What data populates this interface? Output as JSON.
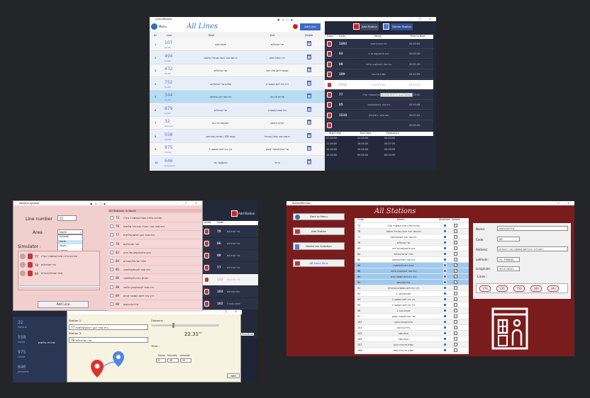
{
  "lines_window": {
    "title": "Lines Window",
    "menu": "Menu",
    "heading": "All Lines",
    "add_line": "Add Line",
    "add_station": "Add Station",
    "delete_station": "Delete Station",
    "cols": {
      "id": "ID",
      "line": "Line",
      "start": "Start",
      "end": "End",
      "delete": "Delete"
    },
    "rows": [
      {
        "id": "1",
        "num": "107",
        "area": "South",
        "start": "שכונת משה",
        "end": "שרי ישראל/ים"
      },
      {
        "id": "2",
        "num": "494",
        "area": "South",
        "start": "יח ספר צבר באור/ בוגרחיל אלמנת",
        "end": "דרך אלוף/ תשש"
      },
      {
        "id": "3",
        "num": "472",
        "area": "South",
        "start": "שרי ישראל/ים",
        "end": "שמואל ידיים/ מלך יקים"
      },
      {
        "id": "4",
        "num": "752",
        "area": "South",
        "start": "מסיטון שרי ישראל/יטב",
        "end": "דרך ביח לחם השושני ק"
      },
      {
        "id": "5",
        "num": "344",
        "area": "South",
        "start": "בית ספר רע/ בנישלחב",
        "end": "שדרות ולה מכי"
      },
      {
        "id": "6",
        "num": "879",
        "area": "South",
        "start": "שרי ישראל/ים",
        "end": "ביח שמחה/משמרת"
      },
      {
        "id": "7",
        "num": "32",
        "area": "General",
        "start": "יעקב/שדרות העת",
        "end": "שדרות אלשמן"
      },
      {
        "id": "8",
        "num": "558",
        "area": "Center",
        "start": "קאפר 700 / שדרות גנות יעקב",
        "end": "יח ספר צבר באור/ בוגרחיל"
      },
      {
        "id": "9",
        "num": "975",
        "area": "Center",
        "start": "דרך ביח לחם השושנה 2",
        "end": "שרי ישראל/שמירי קאופן"
      },
      {
        "id": "10",
        "num": "646",
        "area": "Jerusalem",
        "start": "ראשון/שד' נוה",
        "end": "ברחל"
      }
    ],
    "station_cols": {
      "index": "Index",
      "code": "Code",
      "name": "Name",
      "time": "Time to Next"
    },
    "stations": [
      {
        "code": "1492",
        "name": "בית חבן/רב שמש",
        "time": "00:32:04"
      },
      {
        "code": "83",
        "name": "בכון אלופה/מש של מ",
        "time": "00:09:36"
      },
      {
        "code": "89",
        "name": "בית ספר לבנות/בכון אלמה",
        "time": "00:51:39"
      },
      {
        "code": "109",
        "name": "עשרת מרכזרוד",
        "time": "00:14:09"
      },
      {
        "code": "1511",
        "name": "עשרת מרכזרוד",
        "time": "00:27:01"
      },
      {
        "code": "77",
        "name": "שדרות גולדה מאיר/המשורר אצ\"ג",
        "time": "00:25:42"
      },
      {
        "code": "85",
        "name": "בית ספר לבנות/אלמוגה",
        "time": "00:55:06"
      },
      {
        "code": "1510",
        "name": "קפרא/ים / דשל/עלם",
        "time": "00:07:02"
      },
      {
        "code": "",
        "name": "",
        "time": "00:00:00"
      }
    ],
    "tooltip": "Double Click to view Details",
    "freq_cols": {
      "start": "Start time",
      "end": "End time",
      "freq": "Frequency"
    },
    "freq_rows": [
      {
        "start": "07:00:00",
        "end": "12:05:00",
        "freq": "00:23:00"
      },
      {
        "start": "11:00:00",
        "end": "16:05:00",
        "freq": "00:37:00"
      },
      {
        "start": "15:00:00",
        "end": "20:05:00",
        "freq": "00:29:00"
      },
      {
        "start": "19:00:00",
        "end": "00:05:00",
        "freq": "00:29:00"
      }
    ]
  },
  "addline_window": {
    "title": "AddLine_window",
    "line_number_label": "Line number",
    "line_number_value": "12",
    "area_label": "Area",
    "area_value": "North",
    "area_options": [
      "General",
      "North",
      "South",
      "Center",
      "Jerusalem"
    ],
    "simulator_label": "Simulator :",
    "sim_items": [
      {
        "code": "77",
        "name": "שדרות גולדה מאיר/המשורר אצ\"ג"
      },
      {
        "code": "78",
        "name": "שרי ישראל/ים"
      },
      {
        "code": "84",
        "name": "מלכי ישראל/הטורים"
      }
    ],
    "add_line": "Add Line",
    "all_stations_label": "All Stations in North",
    "north_stations": [
      {
        "code": "73",
        "name": "שדרות גולדה מאיר/המשורר אצ\"ג"
      },
      {
        "code": "76",
        "name": "בית ספר צבר באור/ בוגרחיל אלמנת"
      },
      {
        "code": "77",
        "name": "בית ספר אבן יהושע/אלמנת"
      },
      {
        "code": "78",
        "name": "שרי ישראל/ים"
      },
      {
        "code": "83",
        "name": "בכון אלופה/מש של מרב"
      },
      {
        "code": "84",
        "name": "מלכי ישראל/הטורים"
      },
      {
        "code": "85",
        "name": "בית ספר לבנות/אלמוגה"
      },
      {
        "code": "86",
        "name": "מגרש כדורגל/אלמוגה"
      },
      {
        "code": "88",
        "name": "בית ספר לבנות/בכון אלמה"
      },
      {
        "code": "89",
        "name": "דרך בית לחם השושני קודם"
      },
      {
        "code": "90",
        "name": "גולדה/הרסום"
      }
    ],
    "bg_index": "Index",
    "bg_code": "Code",
    "bg_add_station": "Add Station",
    "bg_codes": [
      "78",
      "86",
      "89",
      "77",
      "112",
      "103",
      "102"
    ],
    "bg_names": [
      "שרי ישראל/ים",
      "שרי ישראל/ים",
      "שרי ישראל/ים",
      "שרי ישראל/ים",
      "שרי ישראל/ים",
      "גולדה/הרסום",
      "שכונת בוכה 2"
    ],
    "bg_end_time": "End time",
    "bg_lines": [
      {
        "num": "32",
        "area": "General"
      },
      {
        "num": "558",
        "area": "Center"
      },
      {
        "num": "975",
        "area": "Center"
      },
      {
        "num": "646",
        "area": "Jerusalem"
      }
    ],
    "bg_line_name": "שדרות אלשמן",
    "sim_panel": {
      "station1_label": "Station 1:",
      "station1_value": "77   בית ספר אבן יהושע/אלמנת",
      "station2_label": "Station 2:",
      "station2_value": "78   שרי ישראל/ים",
      "distance_label": "Distance :",
      "distance_value": "22.31",
      "distance_unit": "Km",
      "time_label": "Time :",
      "hours_label": "Hours",
      "minutes_label": "minutes",
      "seconds_label": "seconds",
      "hours": "0",
      "minutes": "45",
      "seconds": "20",
      "add": "Add"
    }
  },
  "stations_window": {
    "title": "StationWindow",
    "heading": "All Stations",
    "back": "Back to Menu",
    "add_station": "Add Station",
    "delete_selection": "Delete the Selection",
    "all_lines_view": "All Lines View",
    "cols": {
      "code": "Code",
      "name": "Name",
      "disabled": "disabled",
      "delete": "Delete"
    },
    "rows": [
      {
        "code": "73",
        "name": "שדרות גולדה מאיר/המשורר אצ\"ג",
        "sel": false
      },
      {
        "code": "76",
        "name": "בית ספר צבר באור/ בוגרחיל אלמנת",
        "sel": false
      },
      {
        "code": "77",
        "name": "בית ספר אבן יהושע/אלמנת",
        "sel": false
      },
      {
        "code": "78",
        "name": "שרי ישראל/ים",
        "sel": false
      },
      {
        "code": "83",
        "name": "בכון אלופה/מש של מרב",
        "sel": false
      },
      {
        "code": "84",
        "name": "מלכי ישראל/הטורים",
        "sel": false
      },
      {
        "code": "85",
        "name": "בית ספר לבנות/אלמוגה",
        "sel": false
      },
      {
        "code": "86",
        "name": "מגרש כדורגל/אלמוגה",
        "sel": true
      },
      {
        "code": "88",
        "name": "בית ספר לבנות/בכון אלמה",
        "sel": true
      },
      {
        "code": "89",
        "name": "דרך בית לחם השושני קודם",
        "sel": true
      },
      {
        "code": "90",
        "name": "גולדה/הרסום",
        "sel": true
      },
      {
        "code": "91",
        "name": "דרך בית לחם השושני/ההסתדרות",
        "sel": false
      },
      {
        "code": "93",
        "name": "חשון של/ענה 1",
        "sel": false
      },
      {
        "code": "94",
        "name": "דרך בית לחם השושנה 2",
        "sel": false
      },
      {
        "code": "95",
        "name": "דרך בית לחם השושנה א",
        "sel": false
      },
      {
        "code": "96",
        "name": "שכונת בוכה 2",
        "sel": false
      },
      {
        "code": "97",
        "name": "שרי ישראל/שמירי קאופן",
        "sel": false
      },
      {
        "code": "102",
        "name": "גולדה/שדרות מלבה",
        "sel": false
      },
      {
        "code": "103",
        "name": "גולדה/הרסום",
        "sel": false
      },
      {
        "code": "105",
        "name": "גבעת משה",
        "sel": false
      },
      {
        "code": "106",
        "name": "גבעת משה",
        "sel": false
      },
      {
        "code": "107",
        "name": "עשרת מרכזרוד הכהן",
        "sel": false
      },
      {
        "code": "108",
        "name": "עשרת מרכזרוד שמש",
        "sel": false
      }
    ],
    "detail": {
      "name_label": "Name:",
      "name": "גולדה/הרסום",
      "code_label": "Code:",
      "code": "90",
      "address_label": "Address:",
      "address": "רחוב:דרך בית לחם השושנה  עיר: ירושלים",
      "lat_label": "Latitude:",
      "lat": "31.799804",
      "lon_label": "Longitude:",
      "lon": "35.213021",
      "lines_label": "Lines :",
      "lines": [
        "376",
        "376",
        "759",
        "309",
        "393"
      ]
    }
  }
}
